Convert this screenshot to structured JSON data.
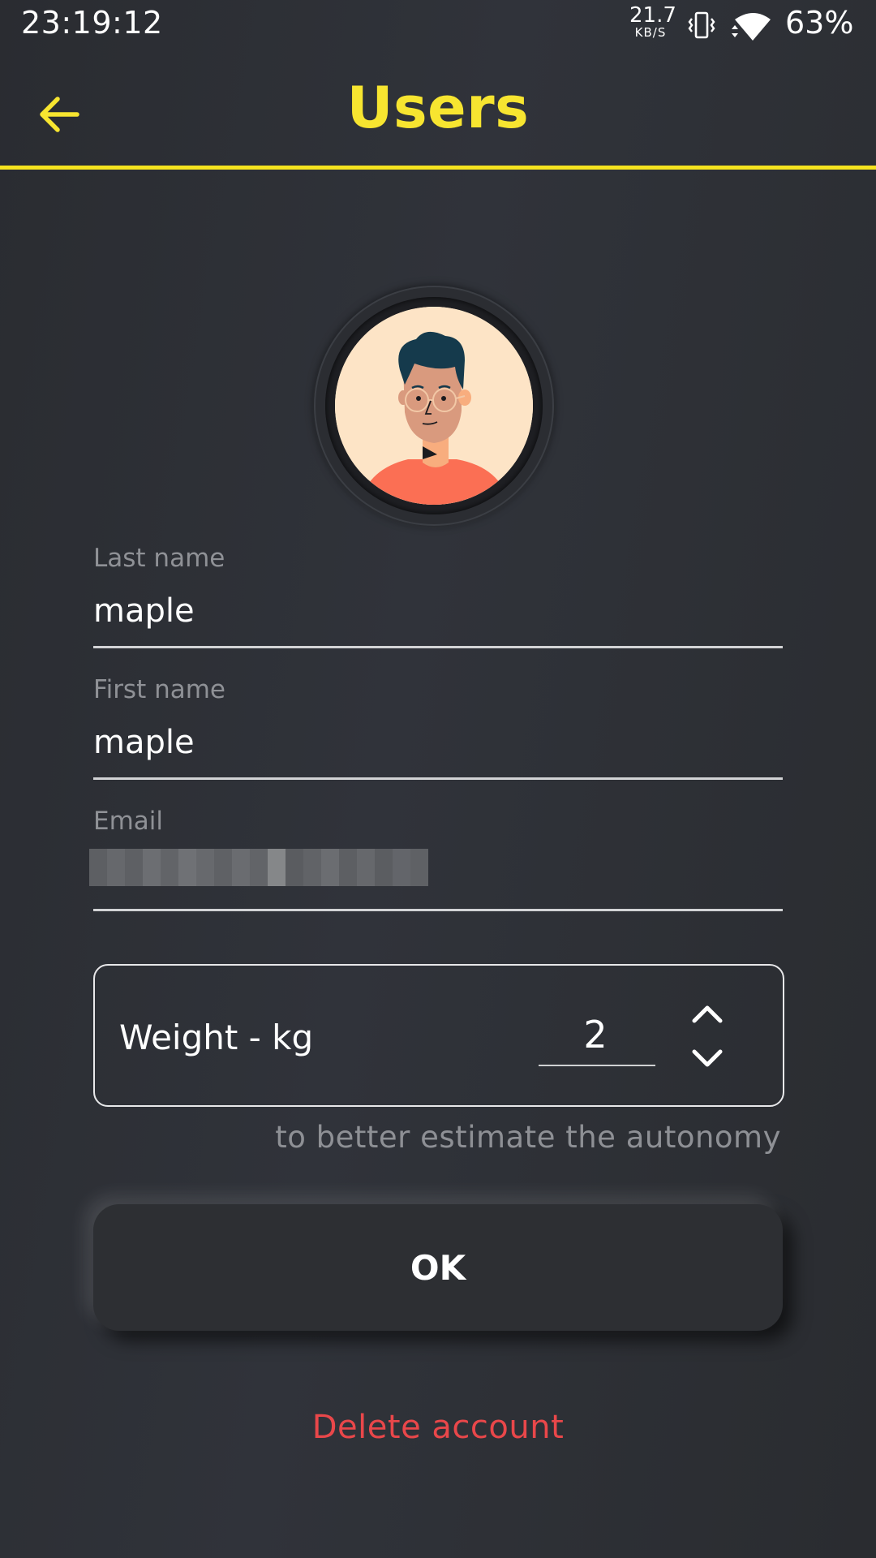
{
  "status_bar": {
    "time": "23:19:12",
    "net_speed_value": "21.7",
    "net_speed_unit": "KB/S",
    "battery": "63%",
    "icons": [
      "vibrate-icon",
      "wifi-icon"
    ]
  },
  "app_bar": {
    "title": "Users",
    "back_icon": "arrow-left-icon",
    "accent_color": "#f7e530"
  },
  "avatar": {
    "icon": "user-avatar-illustration"
  },
  "form": {
    "last_name": {
      "label": "Last name",
      "value": "maple"
    },
    "first_name": {
      "label": "First name",
      "value": "maple"
    },
    "email": {
      "label": "Email",
      "value_obscured": true
    }
  },
  "weight": {
    "label": "Weight - kg",
    "value": "2",
    "hint": "to better estimate the autonomy",
    "icons": [
      "chevron-up-icon",
      "chevron-down-icon"
    ]
  },
  "actions": {
    "ok_label": "OK",
    "delete_label": "Delete account",
    "delete_color": "#e9474a"
  }
}
